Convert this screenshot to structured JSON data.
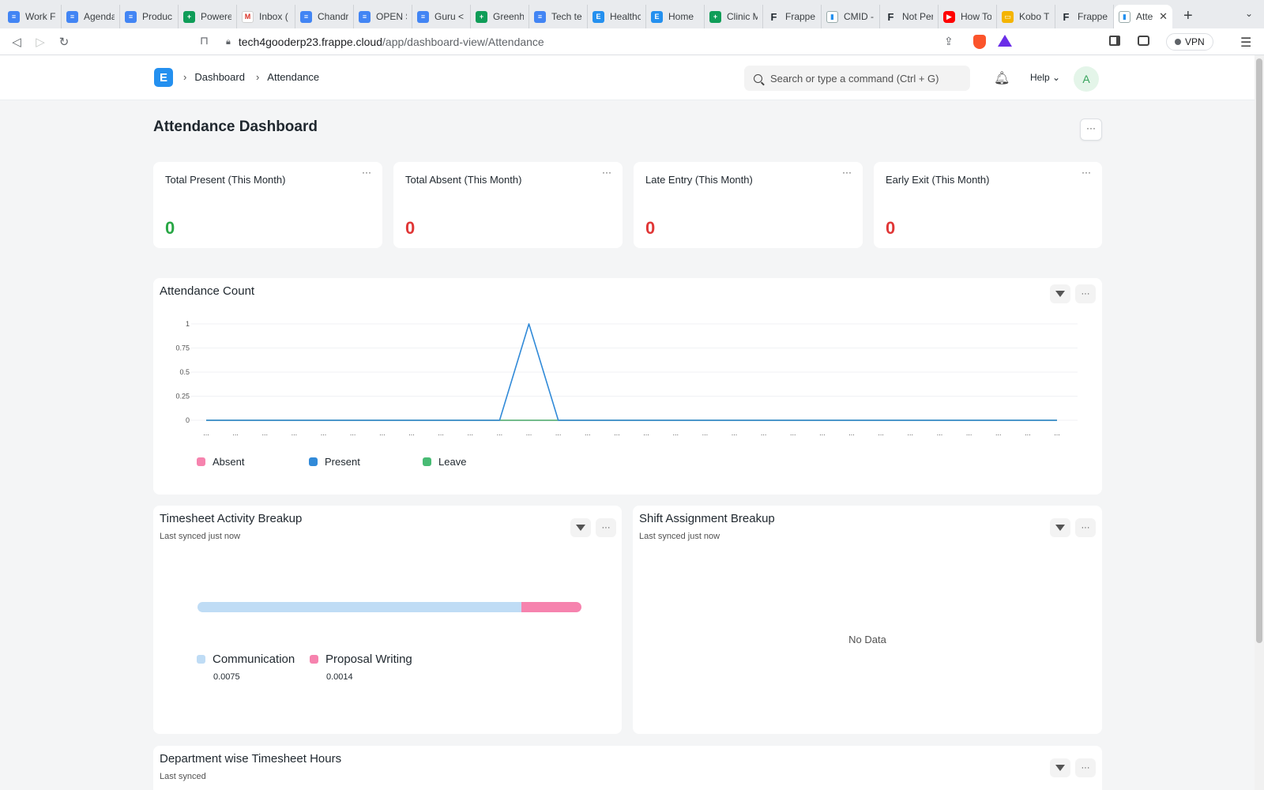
{
  "browser": {
    "tabs": [
      {
        "title": "Work F",
        "icon": "doc"
      },
      {
        "title": "Agenda",
        "icon": "doc"
      },
      {
        "title": "Produc",
        "icon": "doc"
      },
      {
        "title": "Powere",
        "icon": "sheet"
      },
      {
        "title": "Inbox (",
        "icon": "gmail"
      },
      {
        "title": "Chandr",
        "icon": "doc"
      },
      {
        "title": "OPEN S",
        "icon": "doc"
      },
      {
        "title": "Guru <",
        "icon": "doc"
      },
      {
        "title": "Greenh",
        "icon": "sheet"
      },
      {
        "title": "Tech te",
        "icon": "doc"
      },
      {
        "title": "Healthc",
        "icon": "erp"
      },
      {
        "title": "Home",
        "icon": "erp"
      },
      {
        "title": "Clinic M",
        "icon": "sheet"
      },
      {
        "title": "Frappe",
        "icon": "frappe"
      },
      {
        "title": "CMID -",
        "icon": "cmid"
      },
      {
        "title": "Not Per",
        "icon": "frappe"
      },
      {
        "title": "How To",
        "icon": "yt"
      },
      {
        "title": "Kobo T",
        "icon": "slides"
      },
      {
        "title": "Frappe",
        "icon": "frappe"
      },
      {
        "title": "Atte",
        "icon": "cmid",
        "active": true
      }
    ],
    "url_host": "tech4gooderp23.frappe.cloud",
    "url_path": "/app/dashboard-view/Attendance",
    "vpn_label": "VPN"
  },
  "navbar": {
    "logo_letter": "E",
    "breadcrumbs": [
      "Dashboard",
      "Attendance"
    ],
    "search_placeholder": "Search or type a command (Ctrl + G)",
    "help_label": "Help",
    "avatar_initial": "A"
  },
  "page": {
    "title": "Attendance Dashboard",
    "menu_label": "···"
  },
  "number_cards": [
    {
      "title": "Total Present (This Month)",
      "value": "0",
      "color": "#28a745"
    },
    {
      "title": "Total Absent (This Month)",
      "value": "0",
      "color": "#e03636"
    },
    {
      "title": "Late Entry (This Month)",
      "value": "0",
      "color": "#e03636"
    },
    {
      "title": "Early Exit (This Month)",
      "value": "0",
      "color": "#e03636"
    }
  ],
  "attendance_chart": {
    "title": "Attendance Count",
    "legend": [
      {
        "name": "Absent",
        "color": "#f683ae"
      },
      {
        "name": "Present",
        "color": "#318ad8"
      },
      {
        "name": "Leave",
        "color": "#48bb74"
      }
    ]
  },
  "chart_data": {
    "type": "line",
    "title": "Attendance Count",
    "x_tick_label": "...",
    "ylim": [
      0,
      1
    ],
    "yticks": [
      "0",
      "0.25",
      "0.5",
      "0.75",
      "1"
    ],
    "grid": true,
    "legend_position": "bottom-left",
    "series": [
      {
        "name": "Absent",
        "color": "#f683ae",
        "values": [
          0,
          0,
          0,
          0,
          0,
          0,
          0,
          0,
          0,
          0,
          0,
          0,
          0,
          0,
          0,
          0,
          0,
          0,
          0,
          0,
          0,
          0,
          0,
          0,
          0,
          0,
          0,
          0,
          0,
          0
        ]
      },
      {
        "name": "Leave",
        "color": "#48bb74",
        "values": [
          0,
          0,
          0,
          0,
          0,
          0,
          0,
          0,
          0,
          0,
          0,
          0,
          0,
          0,
          0,
          0,
          0,
          0,
          0,
          0,
          0,
          0,
          0,
          0,
          0,
          0,
          0,
          0,
          0,
          0
        ]
      },
      {
        "name": "Present",
        "color": "#318ad8",
        "values": [
          0,
          0,
          0,
          0,
          0,
          0,
          0,
          0,
          0,
          0,
          0,
          1,
          0,
          0,
          0,
          0,
          0,
          0,
          0,
          0,
          0,
          0,
          0,
          0,
          0,
          0,
          0,
          0,
          0,
          0
        ]
      }
    ]
  },
  "timesheet_activity": {
    "title": "Timesheet Activity Breakup",
    "subtitle": "Last synced just now",
    "items": [
      {
        "name": "Communication",
        "value": "0.0075",
        "amount": 0.0075,
        "color": "#bfdcf5"
      },
      {
        "name": "Proposal Writing",
        "value": "0.0014",
        "amount": 0.0014,
        "color": "#f683ae"
      }
    ]
  },
  "shift_assignment": {
    "title": "Shift Assignment Breakup",
    "subtitle": "Last synced just now",
    "empty_text": "No Data"
  },
  "department_timesheet": {
    "title": "Department wise Timesheet Hours",
    "subtitle": "Last synced"
  },
  "widget_menu_label": "···"
}
